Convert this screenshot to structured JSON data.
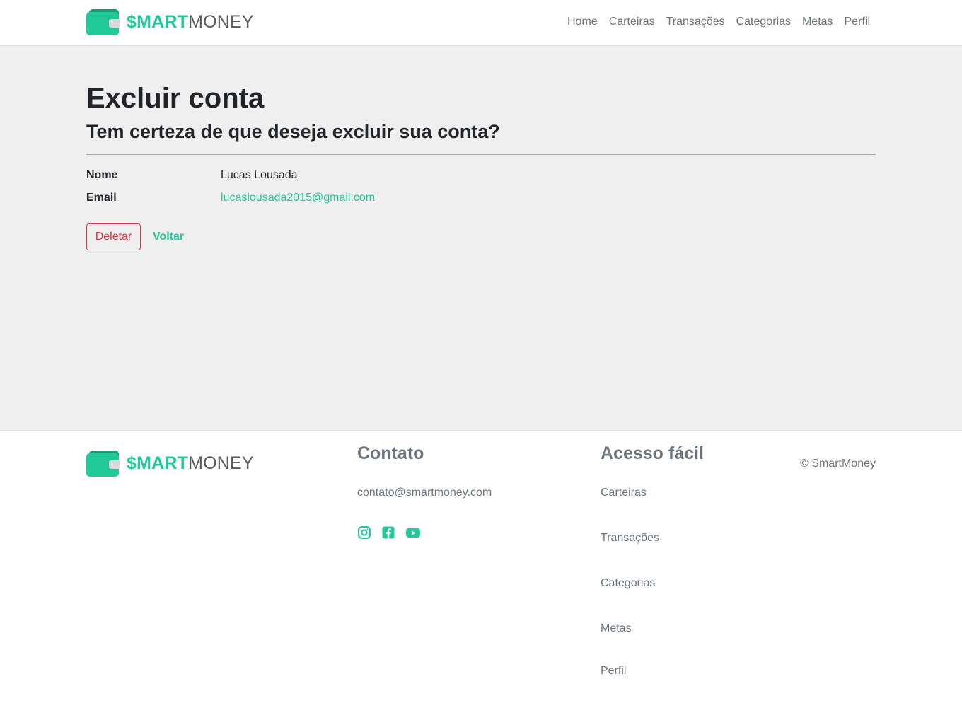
{
  "brand": {
    "logo_bold": "$MART",
    "logo_light": "MONEY"
  },
  "nav": {
    "items": [
      "Home",
      "Carteiras",
      "Transações",
      "Categorias",
      "Metas",
      "Perfil"
    ]
  },
  "main": {
    "title": "Excluir conta",
    "subtitle": "Tem certeza de que deseja excluir sua conta?",
    "fields": [
      {
        "label": "Nome",
        "value": "Lucas Lousada"
      },
      {
        "label": "Email",
        "value": "lucaslousada2015@gmail.com"
      }
    ],
    "delete_label": "Deletar",
    "back_label": "Voltar"
  },
  "footer": {
    "contact_heading": "Contato",
    "contact_email": "contato@smartmoney.com",
    "social_icons": [
      "instagram-icon",
      "facebook-icon",
      "youtube-icon"
    ],
    "quick_heading": "Acesso fácil",
    "quick_links": [
      "Carteiras",
      "Transações",
      "Categorias",
      "Metas",
      "Perfil"
    ],
    "copyright": "© SmartMoney"
  },
  "colors": {
    "accent": "#20c997",
    "danger": "#dc3545",
    "muted": "#6c757d",
    "main_bg": "#efefef"
  }
}
